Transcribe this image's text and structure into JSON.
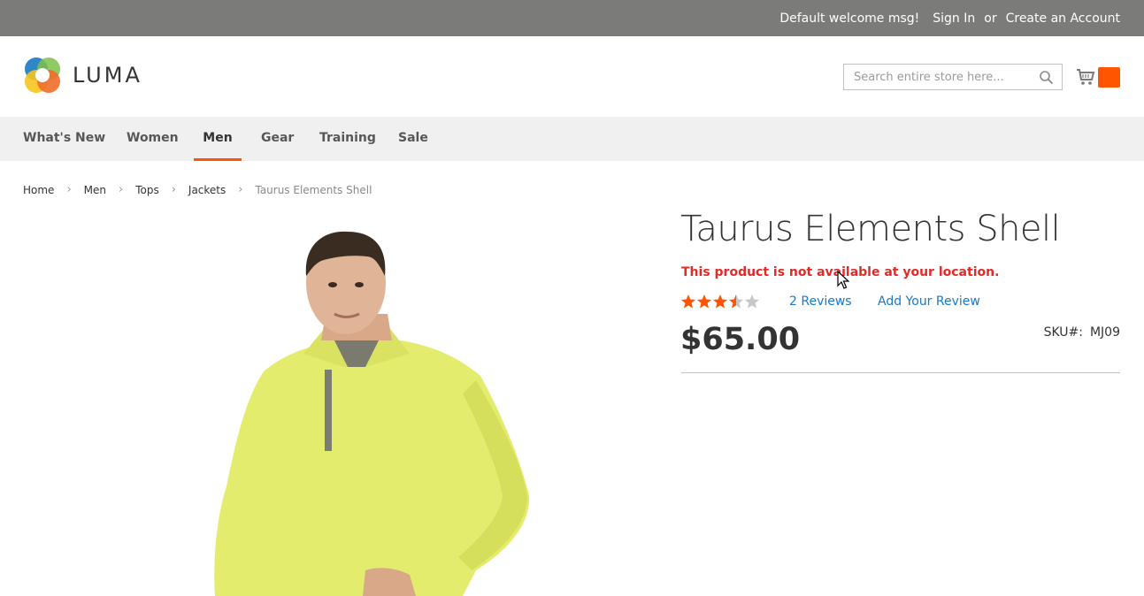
{
  "top_bar": {
    "welcome": "Default welcome msg!",
    "sign_in": "Sign In",
    "or": "or",
    "create_account": "Create an Account"
  },
  "header": {
    "logo_text": "LUMA",
    "search_placeholder": "Search entire store here...",
    "cart_icon": "cart-icon"
  },
  "nav": {
    "items": [
      {
        "label": "What's New"
      },
      {
        "label": "Women"
      },
      {
        "label": "Men",
        "active": true
      },
      {
        "label": "Gear"
      },
      {
        "label": "Training"
      },
      {
        "label": "Sale"
      }
    ]
  },
  "breadcrumb": [
    "Home",
    "Men",
    "Tops",
    "Jackets",
    "Taurus Elements Shell"
  ],
  "product": {
    "title": "Taurus Elements Shell",
    "alert": "This product is not available at your location.",
    "rating_stars": 3.5,
    "rating_max": 5,
    "reviews_link": "2 Reviews",
    "add_review_link": "Add Your Review",
    "price": "$65.00",
    "sku_label": "SKU#:",
    "sku_value": "MJ09"
  },
  "colors": {
    "accent": "#ff5501",
    "link": "#1979c3",
    "error": "#e02b27",
    "topbar": "#7b7b7a",
    "nav_bg": "#f0f0f0"
  }
}
